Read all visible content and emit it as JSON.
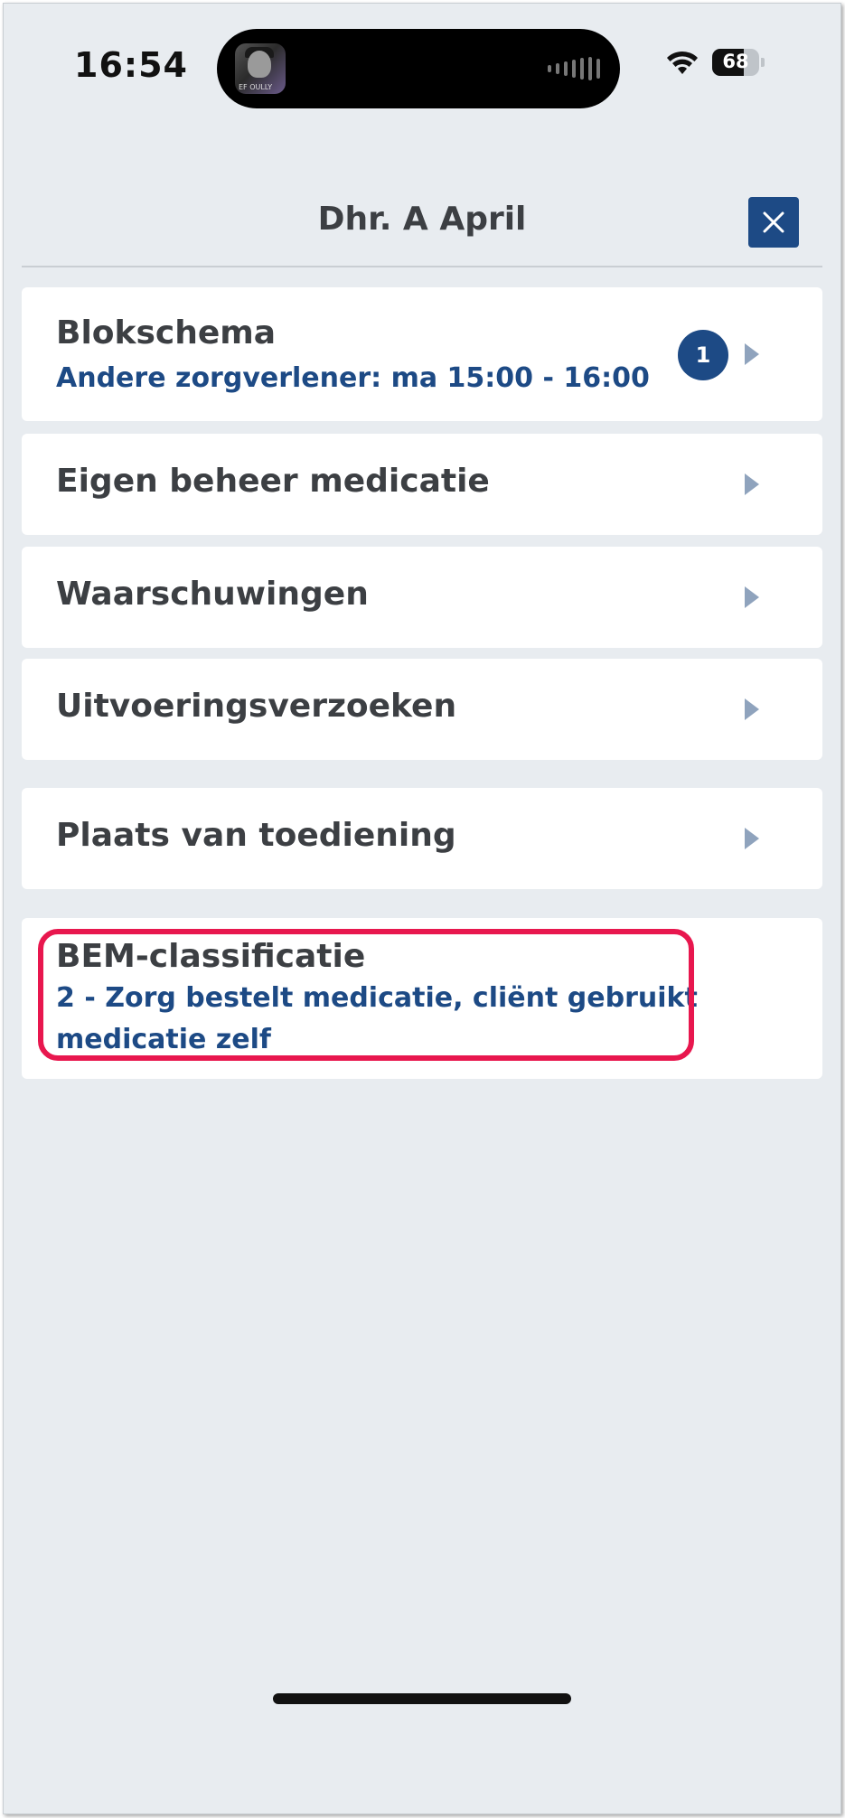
{
  "status_bar": {
    "time": "16:54",
    "battery": "68",
    "island_thumb_text": "EF OULLY"
  },
  "header": {
    "title": "Dhr. A April"
  },
  "items": [
    {
      "title": "Blokschema",
      "subtitle": "Andere zorgverlener: ma 15:00 - 16:00",
      "badge": "1"
    },
    {
      "title": "Eigen beheer medicatie"
    },
    {
      "title": "Waarschuwingen"
    },
    {
      "title": "Uitvoeringsverzoeken"
    },
    {
      "title": "Plaats van toediening"
    },
    {
      "title": "BEM-classificatie",
      "subtitle": "2 - Zorg bestelt medicatie, cliënt gebruikt medicatie zelf"
    }
  ],
  "colors": {
    "accent": "#1d4a85",
    "highlight": "#e8174e",
    "background": "#e8ecf0"
  }
}
